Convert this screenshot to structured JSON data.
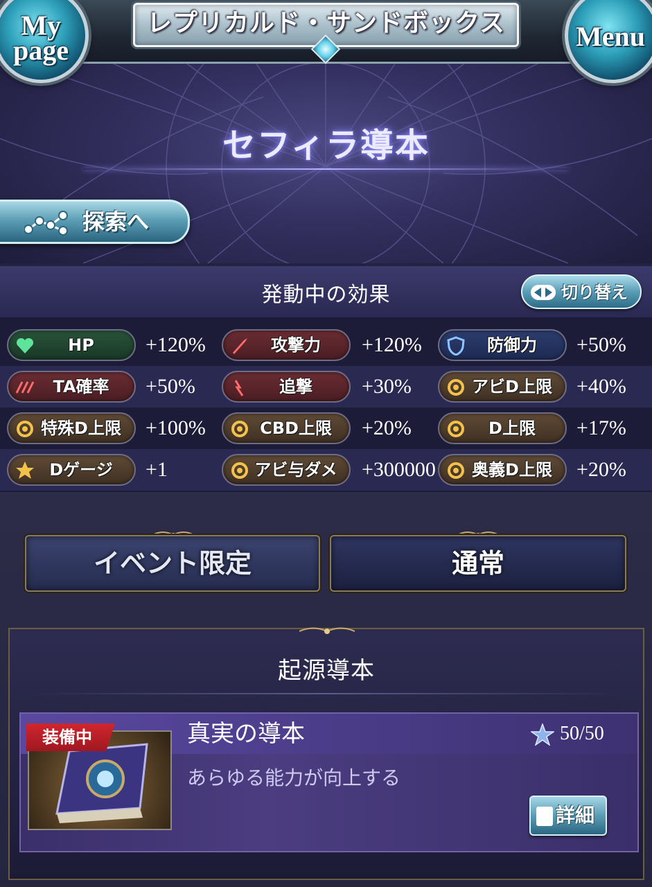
{
  "header": {
    "location_title": "レプリカルド・サンドボックス",
    "mypage_label_1": "My",
    "mypage_label_2": "page",
    "menu_label": "Menu",
    "book_title": "セフィラ導本",
    "explore_label": "探索へ"
  },
  "effects": {
    "title": "発動中の効果",
    "switch_label": "切り替え",
    "rows": [
      [
        {
          "label": "HP",
          "value": "+120%",
          "color": "#29533a",
          "icon": "heart-icon"
        },
        {
          "label": "攻撃力",
          "value": "+120%",
          "color": "#6a2d33",
          "icon": "sword-icon"
        },
        {
          "label": "防御力",
          "value": "+50%",
          "color": "#2c3d6e",
          "icon": "shield-icon"
        }
      ],
      [
        {
          "label": "TA確率",
          "value": "+50%",
          "color": "#6a2d33",
          "icon": "triple-attack-icon"
        },
        {
          "label": "追撃",
          "value": "+30%",
          "color": "#6a2d33",
          "icon": "bonus-attack-icon"
        },
        {
          "label": "アビD上限",
          "value": "+40%",
          "color": "#5f4a35",
          "icon": "skill-damage-cap-icon"
        }
      ],
      [
        {
          "label": "特殊D上限",
          "value": "+100%",
          "color": "#5f4a35",
          "icon": "special-damage-cap-icon"
        },
        {
          "label": "CBD上限",
          "value": "+20%",
          "color": "#5f4a35",
          "icon": "chain-burst-icon"
        },
        {
          "label": "D上限",
          "value": "+17%",
          "color": "#5f4a35",
          "icon": "damage-cap-icon"
        }
      ],
      [
        {
          "label": "Dゲージ",
          "value": "+1",
          "color": "#5f4a35",
          "icon": "star-icon"
        },
        {
          "label": "アビ与ダメ",
          "value": "+300000",
          "color": "#5f4a35",
          "icon": "sun-icon"
        },
        {
          "label": "奥義D上限",
          "value": "+20%",
          "color": "#5f4a35",
          "icon": "charge-attack-cap-icon"
        }
      ]
    ]
  },
  "tabs": {
    "event_label": "イベント限定",
    "normal_label": "通常"
  },
  "origin": {
    "title": "起源導本",
    "equip_tag": "装備中",
    "book_name": "真実の導本",
    "level": "50/50",
    "description": "あらゆる能力が向上する",
    "detail_label": "詳細"
  }
}
